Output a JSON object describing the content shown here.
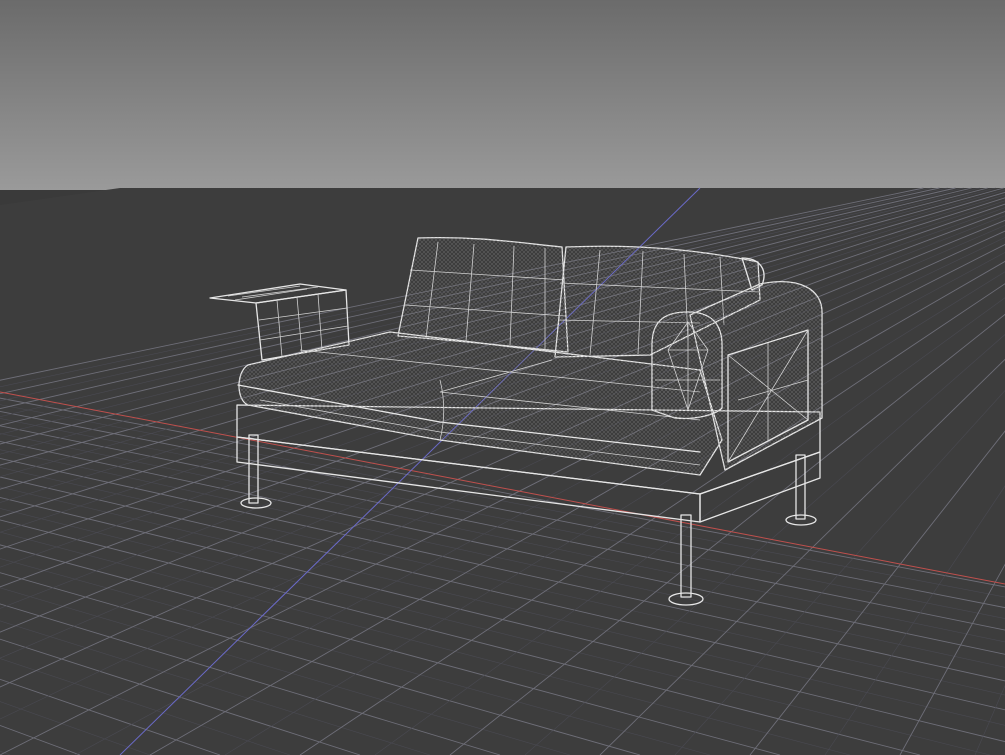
{
  "viewport": {
    "view": "perspective",
    "shading": "wireframe-on-shaded",
    "colors": {
      "sky_top": "#6b6b6b",
      "sky_bottom": "#9a9a9a",
      "ground": "#3d3d3d",
      "grid_major": "#6e6e78",
      "grid_minor": "#4a4a52",
      "axis_x": "#c0504d",
      "axis_z": "#6a6ac8",
      "wire": "#e6e6e6",
      "surface_light": "#5a5a5a",
      "surface_mid": "#474747",
      "surface_dark": "#2a2a2a"
    }
  },
  "scene": {
    "objects": [
      {
        "name": "sofa-seat-cushions"
      },
      {
        "name": "sofa-back-cushions"
      },
      {
        "name": "sofa-right-armrest"
      },
      {
        "name": "sofa-left-side-table"
      },
      {
        "name": "sofa-frame"
      },
      {
        "name": "sofa-legs"
      }
    ]
  }
}
